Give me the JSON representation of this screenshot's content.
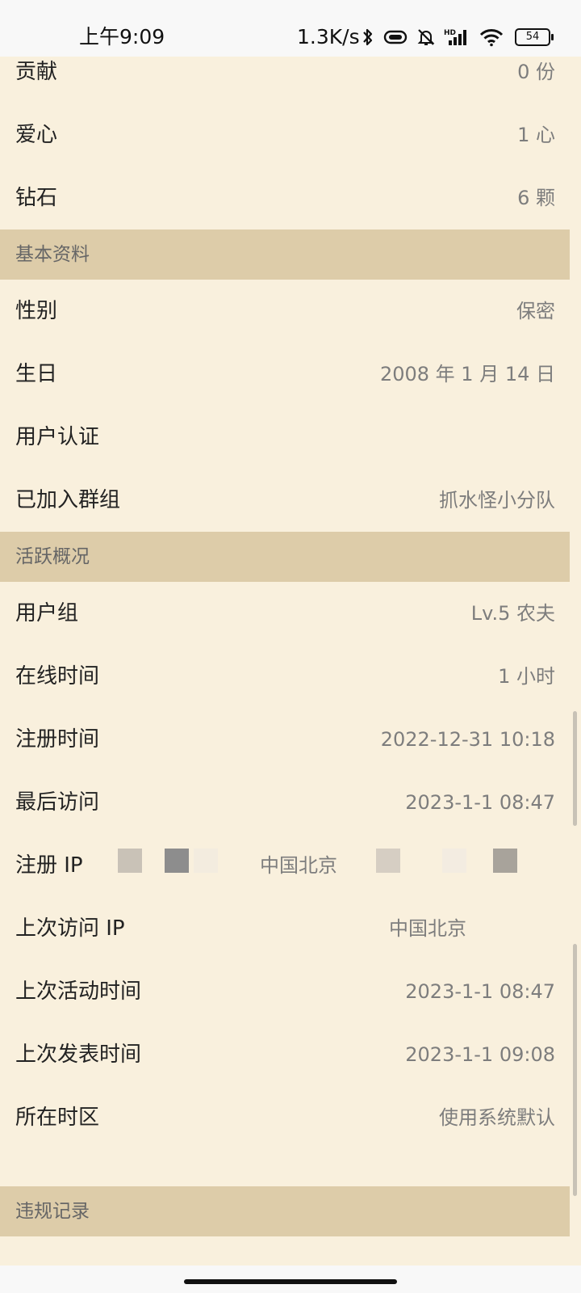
{
  "status_bar": {
    "time": "上午9:09",
    "net_speed": "1.3K/s",
    "icons": [
      "bluetooth-icon",
      "vibrate-icon",
      "mute-icon",
      "hd-signal-icon",
      "wifi-icon",
      "battery-icon"
    ],
    "battery_level": "54"
  },
  "profile": {
    "stats": [
      {
        "label": "贡献",
        "value": "0 份"
      },
      {
        "label": "爱心",
        "value": "1 心"
      },
      {
        "label": "钻石",
        "value": "6 颗"
      }
    ],
    "basic_section": {
      "title": "基本资料",
      "rows": [
        {
          "label": "性别",
          "value": "保密"
        },
        {
          "label": "生日",
          "value": "2008 年 1 月 14 日"
        },
        {
          "label": "用户认证",
          "value": ""
        },
        {
          "label": "已加入群组",
          "value": "抓水怪小分队"
        }
      ]
    },
    "activity_section": {
      "title": "活跃概况",
      "rows": [
        {
          "label": "用户组",
          "value": "Lv.5 农夫"
        },
        {
          "label": "在线时间",
          "value": "1 小时"
        },
        {
          "label": "注册时间",
          "value": "2022-12-31 10:18"
        },
        {
          "label": "最后访问",
          "value": "2023-1-1 08:47"
        },
        {
          "label": "注册 IP",
          "value": "中国北京"
        },
        {
          "label": "上次访问 IP",
          "value": "中国北京"
        },
        {
          "label": "上次活动时间",
          "value": "2023-1-1 08:47"
        },
        {
          "label": "上次发表时间",
          "value": "2023-1-1 09:08"
        },
        {
          "label": "所在时区",
          "value": "使用系统默认"
        }
      ]
    },
    "violation_section": {
      "title": "违规记录"
    }
  },
  "colors": {
    "row_background": "#f9f0dd",
    "section_header_background": "#ddcca9",
    "label_text": "#222222",
    "value_text": "#7d7d7d",
    "status_bar_background": "#f8f8f8"
  }
}
